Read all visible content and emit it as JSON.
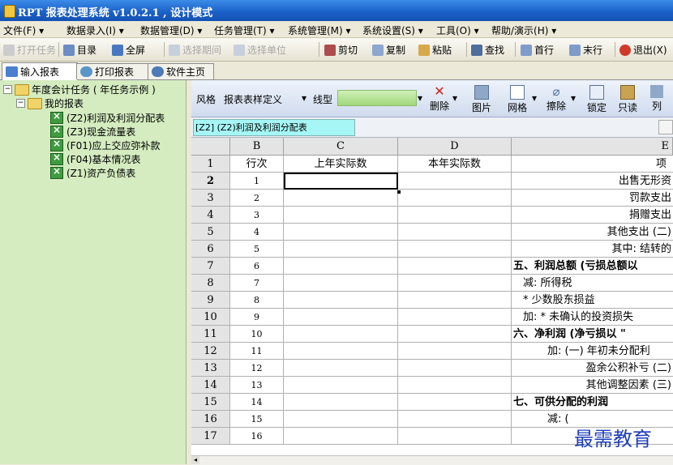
{
  "window": {
    "title": "RPT 报表处理系统 v1.0.2.1 , 设计模式"
  },
  "menu": [
    "文件(F) ▾",
    "数据录入(I) ▾",
    "数据管理(D) ▾",
    "任务管理(T) ▾",
    "系统管理(M) ▾",
    "系统设置(S) ▾",
    "工具(O) ▾",
    "帮助/演示(H) ▾"
  ],
  "toolbar": {
    "open_task": "打开任务",
    "catalog": "目录",
    "fullscreen": "全屏",
    "select_period": "选择期间",
    "select_unit": "选择单位",
    "cut": "剪切",
    "copy": "复制",
    "paste": "粘贴",
    "find": "查找",
    "first_row": "首行",
    "last_row": "末行",
    "exit": "退出(X)"
  },
  "tabs": [
    "输入报表",
    "打印报表",
    "软件主页"
  ],
  "tree": {
    "root": "年度会计任务 ( 年任务示例 )",
    "folder": "我的报表",
    "items": [
      "(Z2)利润及利润分配表",
      "(Z3)现金流量表",
      "(F01)应上交应弥补款",
      "(F04)基本情况表",
      "(Z1)资产负债表"
    ]
  },
  "edit_toolbar": {
    "style_label": "风格",
    "style_value": "报表表样定义",
    "line_label": "线型",
    "delete": "删除",
    "picture": "图片",
    "grid": "网格",
    "erase": "擦除",
    "lock": "锁定",
    "readonly": "只读",
    "col": "列"
  },
  "cell_ref": "[Z2] (Z2)利润及利润分配表",
  "grid": {
    "columns": [
      "B",
      "C",
      "D",
      "E"
    ],
    "header_row": {
      "row": "1",
      "b": "行次",
      "c": "上年实际数",
      "d": "本年实际数",
      "e": "项"
    },
    "rows": [
      {
        "row": "2",
        "b": "1",
        "e": "出售无形资"
      },
      {
        "row": "3",
        "b": "2",
        "e": "罚款支出"
      },
      {
        "row": "4",
        "b": "3",
        "e": "捐赠支出"
      },
      {
        "row": "5",
        "b": "4",
        "e": "(二) 其他支出"
      },
      {
        "row": "6",
        "b": "5",
        "e": "其中: 结转的"
      },
      {
        "row": "7",
        "b": "6",
        "e": "五、利润总额 (亏损总额以"
      },
      {
        "row": "8",
        "b": "7",
        "e": "减: 所得税"
      },
      {
        "row": "9",
        "b": "8",
        "e": "* 少数股东损益"
      },
      {
        "row": "10",
        "b": "9",
        "e": "加: * 未确认的投资损失"
      },
      {
        "row": "11",
        "b": "10",
        "e": "六、净利润 (净亏损以 \""
      },
      {
        "row": "12",
        "b": "11",
        "e": "加: (一) 年初未分配利"
      },
      {
        "row": "13",
        "b": "12",
        "e": "(二) 盈余公积补亏"
      },
      {
        "row": "14",
        "b": "13",
        "e": "(三) 其他调整因素"
      },
      {
        "row": "15",
        "b": "14",
        "e": "七、可供分配的利润"
      },
      {
        "row": "16",
        "b": "15",
        "e": "减: ("
      },
      {
        "row": "17",
        "b": "16",
        "e": ""
      }
    ]
  },
  "watermark": "最需教育",
  "colors": {
    "titlebar": "#1a5fc6",
    "tree_bg": "#d4ecc0",
    "cellref_bg": "#a6f6f6"
  }
}
